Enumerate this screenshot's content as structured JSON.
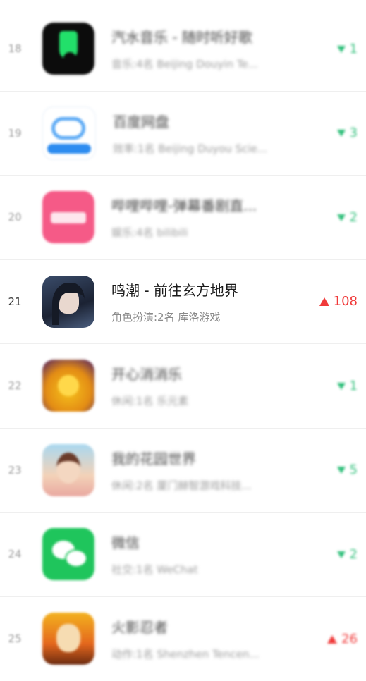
{
  "rows": [
    {
      "rank": "18",
      "title": "汽水音乐 - 随时听好歌",
      "sub": "音乐:4名  Beijing Douyin Te...",
      "change_dir": "down",
      "change": "1",
      "icon": "music-note-icon"
    },
    {
      "rank": "19",
      "title": "百度网盘",
      "sub": "效率:1名  Beijing Duyou Scie...",
      "change_dir": "down",
      "change": "3",
      "icon": "cloud-drive-icon"
    },
    {
      "rank": "20",
      "title": "哔哩哔哩-弹幕番剧直...",
      "sub": "娱乐:4名  bilibili",
      "change_dir": "down",
      "change": "2",
      "icon": "bilibili-icon"
    },
    {
      "rank": "21",
      "title": "鸣潮 - 前往玄方地界",
      "sub": "角色扮演:2名  库洛游戏",
      "change_dir": "up",
      "change": "108",
      "icon": "game-character-icon"
    },
    {
      "rank": "22",
      "title": "开心消消乐",
      "sub": "休闲:1名  乐元素",
      "change_dir": "down",
      "change": "1",
      "icon": "happy-chick-icon"
    },
    {
      "rank": "23",
      "title": "我的花园世界",
      "sub": "休闲:2名  厦门赫智游戏科技...",
      "change_dir": "down",
      "change": "5",
      "icon": "garden-girl-icon"
    },
    {
      "rank": "24",
      "title": "微信",
      "sub": "社交:1名  WeChat",
      "change_dir": "down",
      "change": "2",
      "icon": "wechat-icon"
    },
    {
      "rank": "25",
      "title": "火影忍者",
      "sub": "动作:1名  Shenzhen Tencen...",
      "change_dir": "up",
      "change": "26",
      "icon": "ninja-icon"
    }
  ],
  "colors": {
    "up": "#f03a3a",
    "down": "#2fbf7a"
  }
}
